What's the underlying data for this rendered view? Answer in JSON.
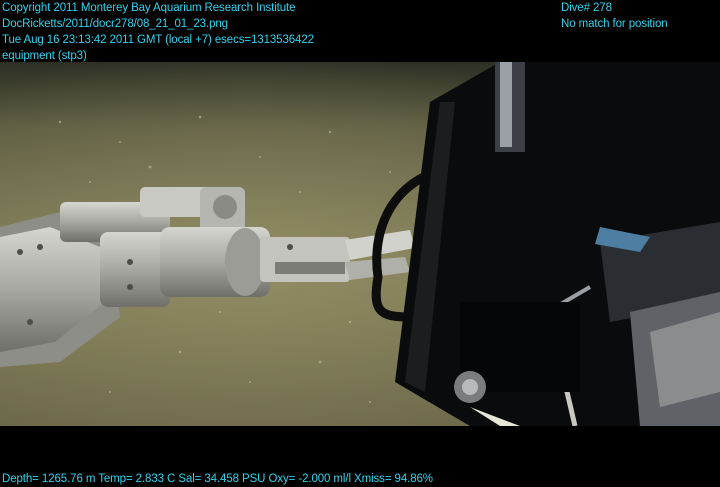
{
  "header": {
    "left_lines": [
      "Copyright 2011 Monterey Bay Aquarium Research Institute",
      "DocRicketts/2011/docr278/08_21_01_23.png",
      "Tue Aug 16 23:13:42 2011 GMT (local +7)  esecs=1313536422",
      "equipment (stp3)"
    ],
    "right_lines": [
      "Dive# 278",
      "No match for position"
    ]
  },
  "footer": {
    "telemetry": "Depth= 1265.76 m  Temp= 2.833 C  Sal= 34.458 PSU  Oxy= -2.000 ml/l  Xmiss= 94.86%"
  },
  "photo": {
    "colors": {
      "seafloor": "#7d7a55",
      "seafloor_dark": "#4b4a33",
      "arm": "#b9b9b4",
      "equipment": "#0a0b0c",
      "cable": "#0d0d0d"
    }
  }
}
